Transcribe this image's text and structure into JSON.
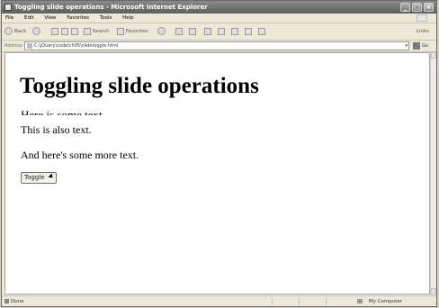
{
  "window": {
    "title": "Toggling slide operations - Microsoft Internet Explorer"
  },
  "menu": [
    "File",
    "Edit",
    "View",
    "Favorites",
    "Tools",
    "Help"
  ],
  "toolbar": {
    "back": "Back",
    "search": "Search",
    "favorites": "Favorites",
    "links": "Links"
  },
  "address": {
    "label": "Address",
    "url": "C:\\jQuery\\code\\ch05\\slidetoggle.html",
    "go": "Go"
  },
  "page": {
    "heading": "Toggling slide operations",
    "text1": "Here is some text.",
    "text2": "This is also text.",
    "text3": "And here's some more text.",
    "button": "Toggle"
  },
  "status": {
    "left": "Done",
    "zone": "My Computer"
  }
}
